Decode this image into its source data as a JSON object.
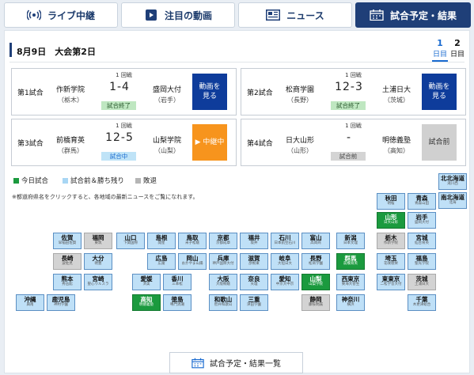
{
  "tabs": [
    {
      "label": "ライブ中継",
      "icon": "broadcast-icon",
      "active": false
    },
    {
      "label": "注目の動画",
      "icon": "play-icon",
      "active": false
    },
    {
      "label": "ニュース",
      "icon": "news-icon",
      "active": false
    },
    {
      "label": "試合予定・結果",
      "icon": "calendar-icon",
      "active": true
    }
  ],
  "schedule": {
    "date_label": "8月9日　大会第2日",
    "days": [
      {
        "num": "1",
        "unit": "日目",
        "active": true
      },
      {
        "num": "2",
        "unit": "日目",
        "active": false
      }
    ]
  },
  "games": [
    {
      "label": "第1試合",
      "round": "1 回戦",
      "home": "作新学院",
      "home_pref": "（栃木）",
      "score": "1-4",
      "away": "盛岡大付",
      "away_pref": "（岩手）",
      "status": "試合終了",
      "status_type": "end",
      "button": "動画を\n見る",
      "button_type": "blue"
    },
    {
      "label": "第2試合",
      "round": "1 回戦",
      "home": "松商学園",
      "home_pref": "（長野）",
      "score": "12-3",
      "away": "土浦日大",
      "away_pref": "（茨城）",
      "status": "試合終了",
      "status_type": "end",
      "button": "動画を\n見る",
      "button_type": "blue"
    },
    {
      "label": "第3試合",
      "round": "1 回戦",
      "home": "前橋育英",
      "home_pref": "（群馬）",
      "score": "12-5",
      "away": "山梨学院",
      "away_pref": "（山梨）",
      "status": "試合中",
      "status_type": "mid",
      "button": "▶ 中継中",
      "button_type": "orange"
    },
    {
      "label": "第4試合",
      "round": "1 回戦",
      "home": "日大山形",
      "home_pref": "（山形）",
      "score": "-",
      "away": "明徳義塾",
      "away_pref": "（高知）",
      "status": "試合前",
      "status_type": "pre",
      "button": "試合前",
      "button_type": "gray"
    }
  ],
  "legend": [
    {
      "label": "今日試合",
      "color": "#1b9a3e"
    },
    {
      "label": "試合前＆勝ち残り",
      "color": "#a8d6f4"
    },
    {
      "label": "敗退",
      "color": "#b5b5b5"
    }
  ],
  "note": "※都道府県名をクリックすると、各地域の最新ニュースをご覧になれます。",
  "prefectures": [
    {
      "name": "北北海道",
      "school": "滝川西",
      "state": "alive"
    },
    {
      "name": "南北海道",
      "school": "北海",
      "state": "alive"
    },
    {
      "name": "秋田",
      "school": "明桜",
      "state": "alive"
    },
    {
      "name": "青森",
      "school": "青森山田",
      "state": "alive"
    },
    {
      "name": "山形",
      "school": "日大山形",
      "state": "today"
    },
    {
      "name": "岩手",
      "school": "盛岡大付",
      "state": "alive"
    },
    {
      "name": "佐賀",
      "school": "早稲田佐賀",
      "state": "alive"
    },
    {
      "name": "福岡",
      "school": "東筑",
      "state": "done"
    },
    {
      "name": "山口",
      "school": "下関国際",
      "state": "alive"
    },
    {
      "name": "島根",
      "school": "開星",
      "state": "alive"
    },
    {
      "name": "鳥取",
      "school": "米子松蔭",
      "state": "alive"
    },
    {
      "name": "京都",
      "school": "京都成章",
      "state": "alive"
    },
    {
      "name": "福井",
      "school": "坂井",
      "state": "alive"
    },
    {
      "name": "石川",
      "school": "日本航空石川",
      "state": "alive"
    },
    {
      "name": "富山",
      "school": "高岡商",
      "state": "alive"
    },
    {
      "name": "新潟",
      "school": "日本文理",
      "state": "alive"
    },
    {
      "name": "栃木",
      "school": "作新学院",
      "state": "done"
    },
    {
      "name": "宮城",
      "school": "仙台育英",
      "state": "alive"
    },
    {
      "name": "長崎",
      "school": "波佐見",
      "state": "done"
    },
    {
      "name": "大分",
      "school": "明豊",
      "state": "alive"
    },
    {
      "name": "広島",
      "school": "広陵",
      "state": "alive"
    },
    {
      "name": "岡山",
      "school": "おかやま山陽",
      "state": "alive"
    },
    {
      "name": "兵庫",
      "school": "神戸国際大付",
      "state": "alive"
    },
    {
      "name": "滋賀",
      "school": "彦根東",
      "state": "alive"
    },
    {
      "name": "岐阜",
      "school": "大垣日大",
      "state": "alive"
    },
    {
      "name": "長野",
      "school": "松商学園",
      "state": "alive"
    },
    {
      "name": "群馬",
      "school": "前橋育英",
      "state": "today"
    },
    {
      "name": "埼玉",
      "school": "花咲徳栄",
      "state": "alive"
    },
    {
      "name": "福島",
      "school": "聖光学院",
      "state": "alive"
    },
    {
      "name": "熊本",
      "school": "秀岳館",
      "state": "alive"
    },
    {
      "name": "宮崎",
      "school": "聖心ウルスラ",
      "state": "alive"
    },
    {
      "name": "愛媛",
      "school": "済美",
      "state": "alive"
    },
    {
      "name": "香川",
      "school": "三本松",
      "state": "alive"
    },
    {
      "name": "大阪",
      "school": "大阪桐蔭",
      "state": "alive"
    },
    {
      "name": "奈良",
      "school": "天理",
      "state": "alive"
    },
    {
      "name": "愛知",
      "school": "中京大中京",
      "state": "alive"
    },
    {
      "name": "山梨",
      "school": "山梨学院",
      "state": "today"
    },
    {
      "name": "西東京",
      "school": "東海大菅生",
      "state": "alive"
    },
    {
      "name": "東東京",
      "school": "二松学舎大付",
      "state": "alive"
    },
    {
      "name": "茨城",
      "school": "土浦日大",
      "state": "done"
    },
    {
      "name": "沖縄",
      "school": "興南",
      "state": "alive"
    },
    {
      "name": "鹿児島",
      "school": "神村学園",
      "state": "alive"
    },
    {
      "name": "高知",
      "school": "明徳義塾",
      "state": "today"
    },
    {
      "name": "徳島",
      "school": "鳴門渦潮",
      "state": "alive"
    },
    {
      "name": "和歌山",
      "school": "智弁和歌山",
      "state": "alive"
    },
    {
      "name": "三重",
      "school": "津田学園",
      "state": "alive"
    },
    {
      "name": "静岡",
      "school": "藤枝明誠",
      "state": "done"
    },
    {
      "name": "神奈川",
      "school": "横浜",
      "state": "alive"
    },
    {
      "name": "千葉",
      "school": "木更津総合",
      "state": "alive"
    }
  ],
  "list_button": "試合予定・結果一覧"
}
